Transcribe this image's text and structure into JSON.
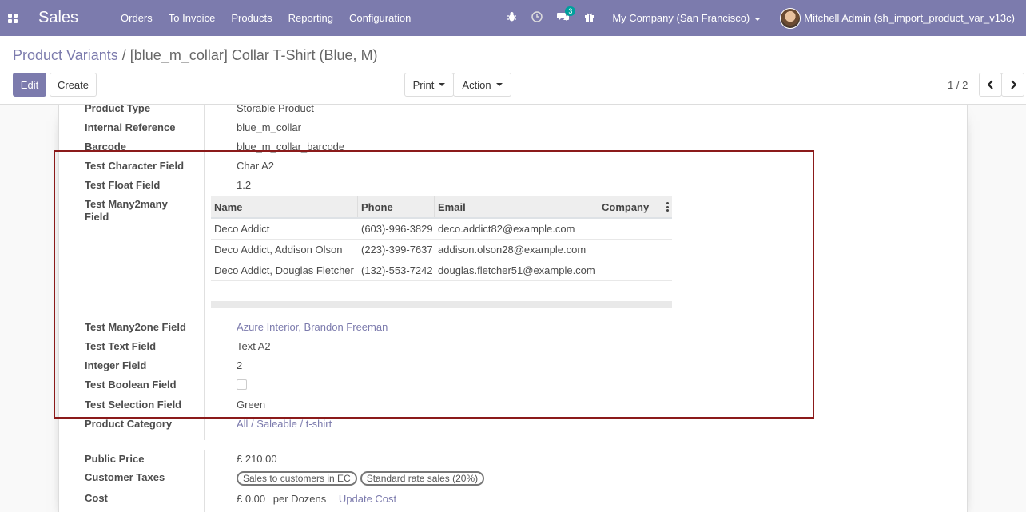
{
  "navbar": {
    "brand": "Sales",
    "menu": [
      "Orders",
      "To Invoice",
      "Products",
      "Reporting",
      "Configuration"
    ],
    "chat_badge": "3",
    "company": "My Company (San Francisco)",
    "user": "Mitchell Admin (sh_import_product_var_v13c)"
  },
  "breadcrumb": {
    "parent": "Product Variants",
    "separator": "/",
    "current": "[blue_m_collar] Collar T-Shirt (Blue, M)"
  },
  "buttons": {
    "edit": "Edit",
    "create": "Create",
    "print": "Print",
    "action": "Action"
  },
  "pager": {
    "value": "1 / 2"
  },
  "fields": {
    "product_type": {
      "label": "Product Type",
      "value": "Storable Product"
    },
    "internal_ref": {
      "label": "Internal Reference",
      "value": "blue_m_collar"
    },
    "barcode": {
      "label": "Barcode",
      "value": "blue_m_collar_barcode"
    },
    "test_char": {
      "label": "Test Character Field",
      "value": "Char A2"
    },
    "test_float": {
      "label": "Test Float Field",
      "value": "1.2"
    },
    "test_m2m": {
      "label": "Test Many2many Field"
    },
    "test_m2o": {
      "label": "Test Many2one Field",
      "value": "Azure Interior, Brandon Freeman"
    },
    "test_text": {
      "label": "Test Text Field",
      "value": "Text A2"
    },
    "integer": {
      "label": "Integer Field",
      "value": "2"
    },
    "test_bool": {
      "label": "Test Boolean Field"
    },
    "test_sel": {
      "label": "Test Selection Field",
      "value": "Green"
    },
    "category": {
      "label": "Product Category",
      "value": "All / Saleable / t-shirt"
    },
    "public_price": {
      "label": "Public Price",
      "value": "£ 210.00"
    },
    "customer_taxes": {
      "label": "Customer Taxes",
      "tags": [
        "Sales to customers in EC",
        "Standard rate sales (20%)"
      ]
    },
    "cost": {
      "label": "Cost",
      "value": "£ 0.00",
      "unit": "per Dozens",
      "update": "Update Cost"
    }
  },
  "m2m_table": {
    "headers": [
      "Name",
      "Phone",
      "Email",
      "Company"
    ],
    "rows": [
      [
        "Deco Addict",
        "(603)-996-3829",
        "deco.addict82@example.com",
        ""
      ],
      [
        "Deco Addict, Addison Olson",
        "(223)-399-7637",
        "addison.olson28@example.com",
        ""
      ],
      [
        "Deco Addict, Douglas Fletcher",
        "(132)-553-7242",
        "douglas.fletcher51@example.com",
        ""
      ]
    ]
  }
}
